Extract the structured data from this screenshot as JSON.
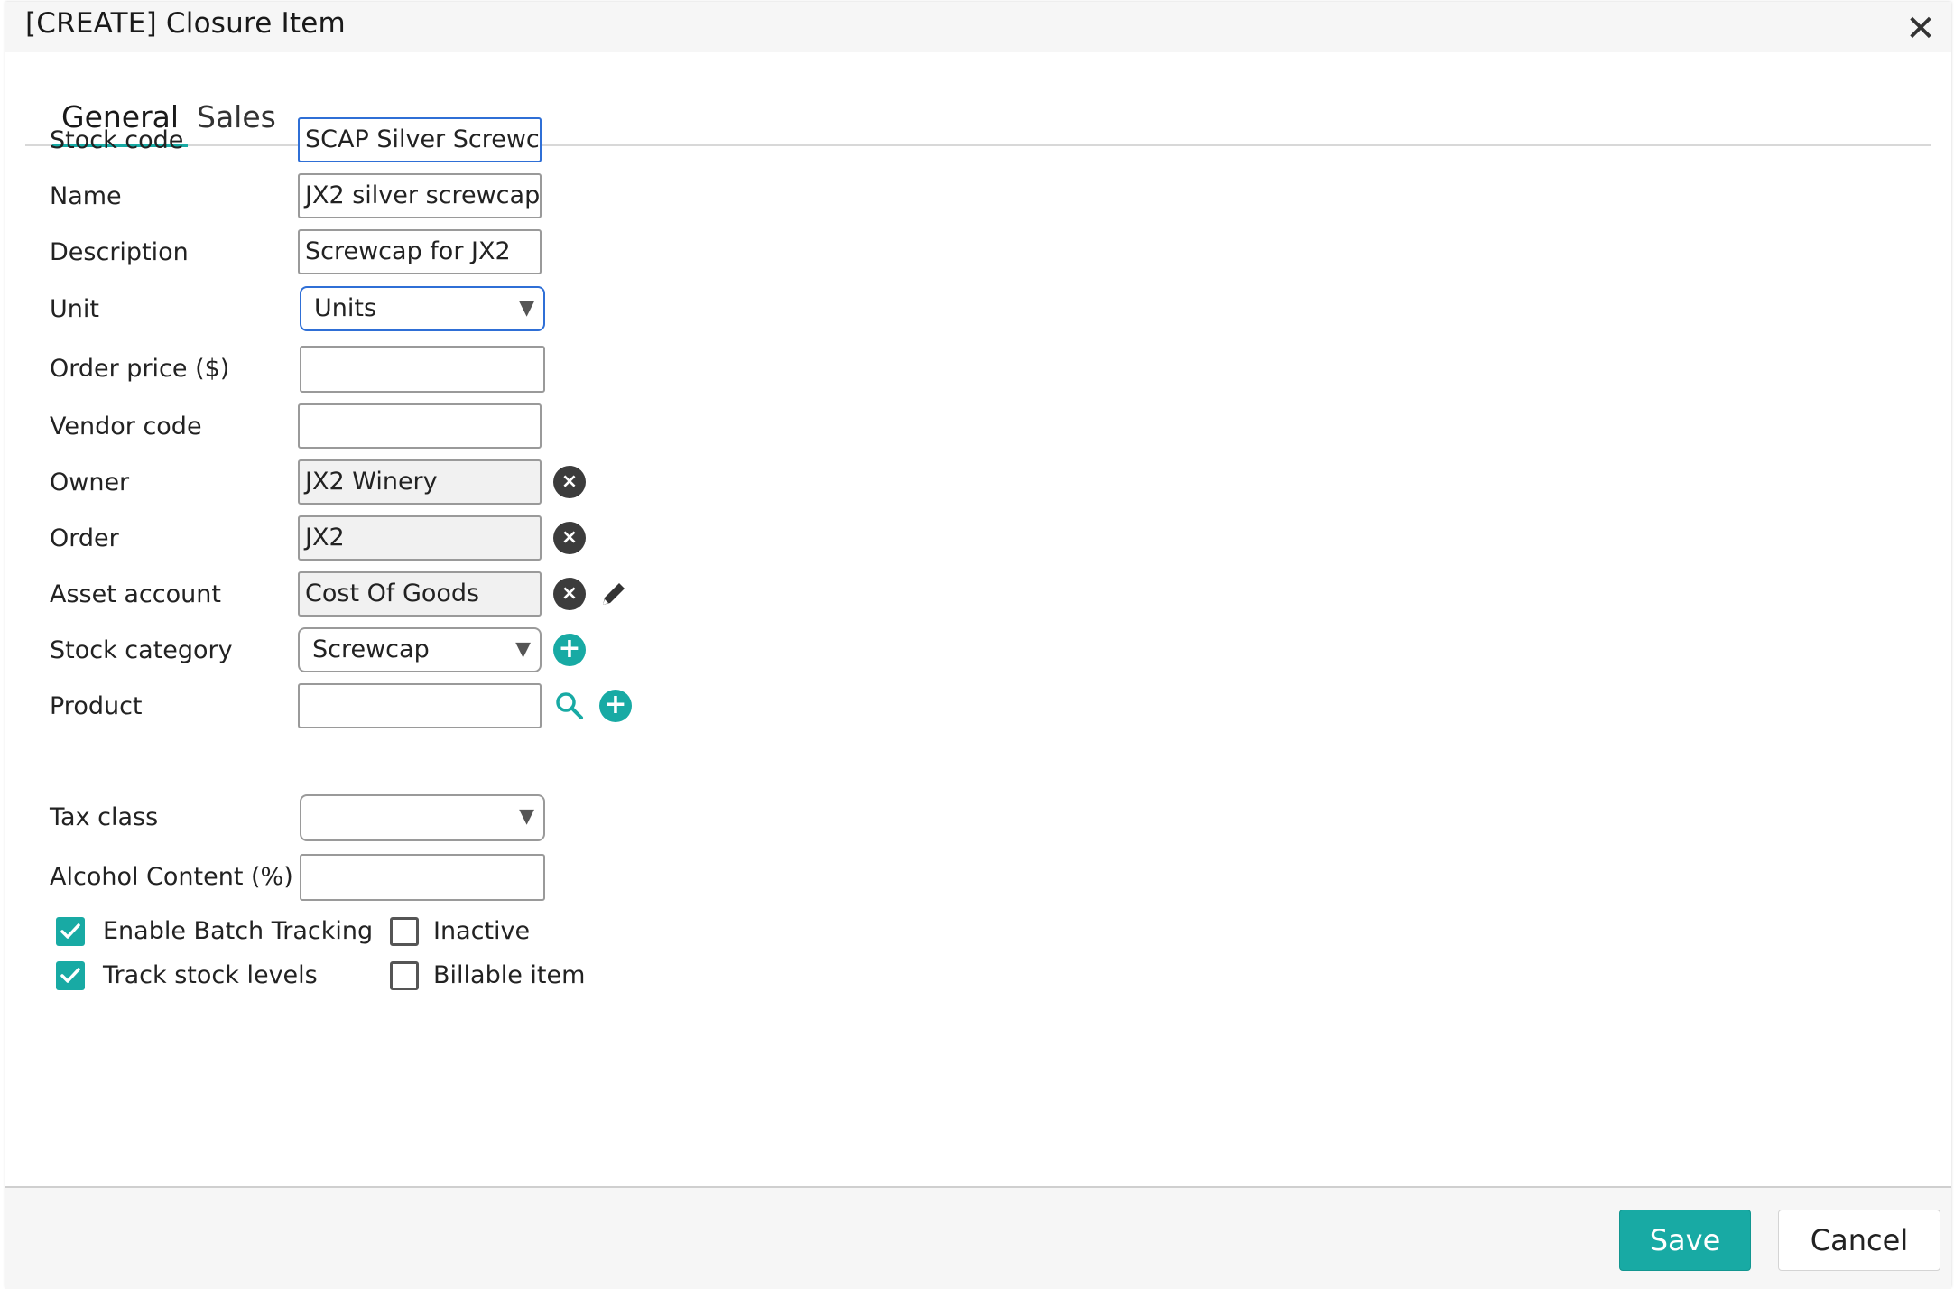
{
  "dialog": {
    "title": "[CREATE] Closure Item",
    "close_glyph": "✕"
  },
  "tabs": [
    {
      "label": "General",
      "active": true
    },
    {
      "label": "Sales",
      "active": false
    }
  ],
  "form": {
    "stock_code": {
      "label": "Stock code",
      "value": "SCAP Silver Screwcap"
    },
    "name": {
      "label": "Name",
      "value": "JX2 silver screwcap"
    },
    "description": {
      "label": "Description",
      "value": "Screwcap for JX2"
    },
    "unit": {
      "label": "Unit",
      "value": "Units"
    },
    "order_price": {
      "label": "Order price ($)",
      "value": ""
    },
    "vendor_code": {
      "label": "Vendor code",
      "value": ""
    },
    "owner": {
      "label": "Owner",
      "value": "JX2 Winery"
    },
    "order": {
      "label": "Order",
      "value": "JX2"
    },
    "asset_account": {
      "label": "Asset account",
      "value": "Cost Of Goods"
    },
    "stock_category": {
      "label": "Stock category",
      "value": "Screwcap"
    },
    "product": {
      "label": "Product",
      "value": ""
    },
    "tax_class": {
      "label": "Tax class",
      "value": ""
    },
    "alcohol_content": {
      "label": "Alcohol Content (%)",
      "value": ""
    }
  },
  "checkboxes": {
    "enable_batch_tracking": {
      "label": "Enable Batch Tracking",
      "checked": true
    },
    "inactive": {
      "label": "Inactive",
      "checked": false
    },
    "track_stock_levels": {
      "label": "Track stock levels",
      "checked": true
    },
    "billable_item": {
      "label": "Billable item",
      "checked": false
    }
  },
  "icons": {
    "clear": "×",
    "plus": "+",
    "caret": "▼",
    "check": "✓"
  },
  "footer": {
    "save_label": "Save",
    "cancel_label": "Cancel"
  },
  "colors": {
    "accent": "#18aaa4",
    "focus_border": "#2f6fd6",
    "clear_icon": "#3c3c3c"
  }
}
